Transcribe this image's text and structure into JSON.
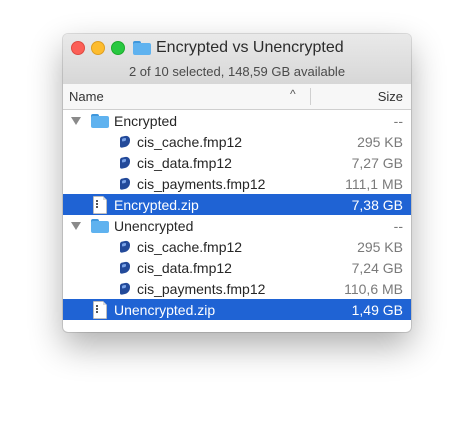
{
  "colors": {
    "selection": "#1f63d4",
    "folder_blue": "#5fb2ef",
    "folder_tab": "#3f97dc",
    "db_icon": "#234a9a"
  },
  "window": {
    "title": "Encrypted vs Unencrypted",
    "folder_icon": "folder-icon",
    "status": "2 of 10 selected, 148,59 GB available"
  },
  "header": {
    "name": "Name",
    "sort_arrow": "^",
    "size": "Size"
  },
  "rows": [
    {
      "type": "folder",
      "label": "Encrypted",
      "size": "--",
      "selected": false,
      "icon": "folder-icon",
      "expanded": true
    },
    {
      "type": "file",
      "label": "cis_cache.fmp12",
      "size": "295 KB",
      "selected": false,
      "icon": "filemaker-db-icon"
    },
    {
      "type": "file",
      "label": "cis_data.fmp12",
      "size": "7,27 GB",
      "selected": false,
      "icon": "filemaker-db-icon"
    },
    {
      "type": "file",
      "label": "cis_payments.fmp12",
      "size": "111,1 MB",
      "selected": false,
      "icon": "filemaker-db-icon"
    },
    {
      "type": "zip",
      "label": "Encrypted.zip",
      "size": "7,38 GB",
      "selected": true,
      "icon": "zip-document-icon"
    },
    {
      "type": "folder",
      "label": "Unencrypted",
      "size": "--",
      "selected": false,
      "icon": "folder-icon",
      "expanded": true
    },
    {
      "type": "file",
      "label": "cis_cache.fmp12",
      "size": "295 KB",
      "selected": false,
      "icon": "filemaker-db-icon"
    },
    {
      "type": "file",
      "label": "cis_data.fmp12",
      "size": "7,24 GB",
      "selected": false,
      "icon": "filemaker-db-icon"
    },
    {
      "type": "file",
      "label": "cis_payments.fmp12",
      "size": "110,6 MB",
      "selected": false,
      "icon": "filemaker-db-icon"
    },
    {
      "type": "zip",
      "label": "Unencrypted.zip",
      "size": "1,49 GB",
      "selected": true,
      "icon": "zip-document-icon"
    }
  ]
}
